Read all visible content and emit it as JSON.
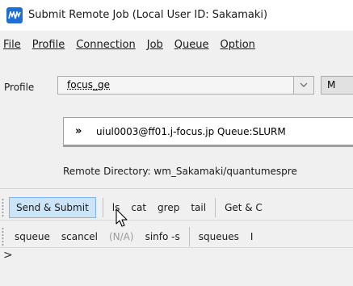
{
  "window": {
    "title": "Submit Remote Job  (Local User ID: Sakamaki)",
    "icon": "app-logo-icon",
    "accent_color": "#1f6fd1"
  },
  "menu": {
    "file": "File",
    "profile": "Profile",
    "connection": "Connection",
    "job": "Job",
    "queue": "Queue",
    "options": "Option"
  },
  "profile": {
    "label": "Profile",
    "selected": "focus_ge",
    "extra_button": "M"
  },
  "host": {
    "chevron": "»",
    "text": "uiul0003@ff01.j-focus.jp   Queue:SLURM"
  },
  "remote_dir": {
    "text": "Remote Directory: wm_Sakamaki/quantumespre"
  },
  "toolbar1": {
    "send_submit": "Send & Submit",
    "ls": "ls",
    "cat": "cat",
    "grep": "grep",
    "tail": "tail",
    "get": "Get & C"
  },
  "toolbar2": {
    "squeue": "squeue",
    "scancel": "scancel",
    "na": "(N/A)",
    "sinfo": "sinfo -s",
    "squeues": "squeues",
    "more": "I"
  },
  "console": {
    "prompt": ">"
  },
  "icons": {
    "dropdown": "chevron-down-icon",
    "cursor": "mouse-pointer-icon"
  }
}
